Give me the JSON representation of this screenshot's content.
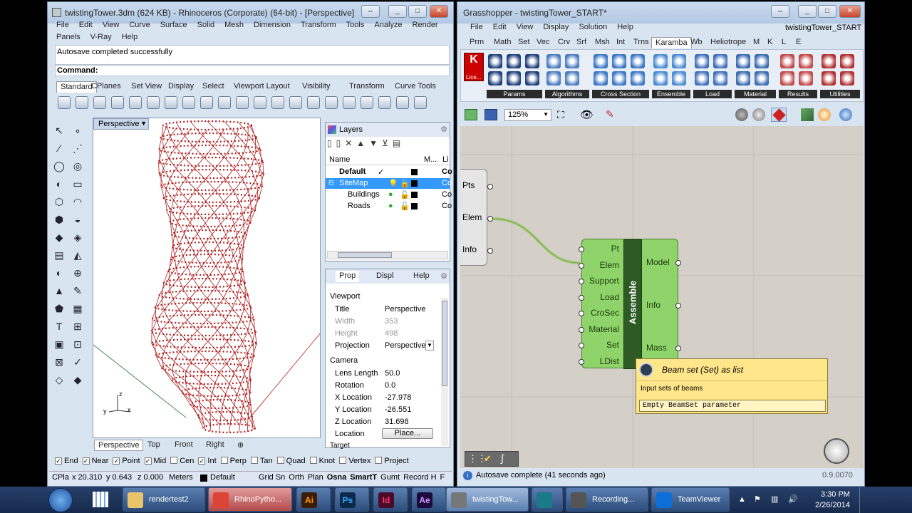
{
  "rhino": {
    "title": "twistingTower.3dm (624 KB) - Rhinoceros (Corporate) (64-bit) - [Perspective]",
    "menu_row1": [
      "File",
      "Edit",
      "View",
      "Curve",
      "Surface",
      "Solid",
      "Mesh",
      "Dimension",
      "Transform",
      "Tools",
      "Analyze",
      "Render"
    ],
    "menu_row2": [
      "Panels",
      "V-Ray",
      "Help"
    ],
    "history": "Autosave completed successfully",
    "command_label": "Command:",
    "toolbar_tabs": [
      "Standard",
      "CPlanes",
      "Set View",
      "Display",
      "Select",
      "Viewport Layout",
      "Visibility",
      "Transform",
      "Curve Tools"
    ],
    "viewport_label": "Perspective",
    "viewport_tabs": [
      "Perspective",
      "Top",
      "Front",
      "Right"
    ],
    "axis_y": "y",
    "axis_z": "z",
    "axis_x": "x",
    "osnap": [
      {
        "label": "End",
        "checked": true
      },
      {
        "label": "Near",
        "checked": true
      },
      {
        "label": "Point",
        "checked": true
      },
      {
        "label": "Mid",
        "checked": true
      },
      {
        "label": "Cen",
        "checked": false
      },
      {
        "label": "Int",
        "checked": true
      },
      {
        "label": "Perp",
        "checked": false
      },
      {
        "label": "Tan",
        "checked": false
      },
      {
        "label": "Quad",
        "checked": false
      },
      {
        "label": "Knot",
        "checked": false
      },
      {
        "label": "Vertex",
        "checked": false
      },
      {
        "label": "Project",
        "checked": false
      }
    ],
    "status": {
      "cplane": "CPla",
      "x": "x 20.310",
      "y": "y 0.643",
      "z": "z 0.000",
      "units": "Meters",
      "layer": "Default",
      "toggles": [
        "Grid Sn",
        "Orth",
        "Plan",
        "Osna",
        "SmartT",
        "Gumt",
        "Record H",
        "F"
      ]
    },
    "layers": {
      "title": "Layers",
      "col_name": "Name",
      "col_m": "M...",
      "col_li": "Li",
      "rows": [
        {
          "name": "Default",
          "extra": "Co"
        },
        {
          "name": "SiteMap",
          "extra": "Co"
        },
        {
          "name": "Buildings",
          "extra": "Co"
        },
        {
          "name": "Roads",
          "extra": "Co"
        }
      ],
      "check": "✓"
    },
    "props": {
      "tabs": [
        "Prop",
        "Displ",
        "Help"
      ],
      "section_viewport": "Viewport",
      "title_k": "Title",
      "title_v": "Perspective",
      "width_k": "Width",
      "width_v": "353",
      "height_k": "Height",
      "height_v": "498",
      "proj_k": "Projection",
      "proj_v": "Perspective",
      "section_camera": "Camera",
      "lens_k": "Lens Length",
      "lens_v": "50.0",
      "rot_k": "Rotation",
      "rot_v": "0.0",
      "xl_k": "X Location",
      "xl_v": "-27.978",
      "yl_k": "Y Location",
      "yl_v": "-26.551",
      "zl_k": "Z Location",
      "zl_v": "31.698",
      "loc_k": "Location",
      "loc_btn": "Place...",
      "target": "Target"
    }
  },
  "gh": {
    "title": "Grasshopper - twistingTower_START*",
    "doc_name": "twistingTower_START",
    "menu": [
      "File",
      "Edit",
      "View",
      "Display",
      "Solution",
      "Help"
    ],
    "tabs": [
      "Prm",
      "Math",
      "Set",
      "Vec",
      "Crv",
      "Srf",
      "Msh",
      "Int",
      "Trns",
      "Karamba",
      "Wb",
      "Heliotrope",
      "M",
      "K",
      "L",
      "E"
    ],
    "active_tab": "Karamba",
    "lic_label": "Lice...",
    "groups": [
      "Params",
      "Algorithms",
      "Cross Section",
      "Ensemble",
      "Load",
      "Material",
      "Results",
      "Utilities"
    ],
    "zoom": "125%",
    "left_outputs": [
      "Pts",
      "Elem",
      "Info"
    ],
    "component": {
      "name": "Assemble",
      "inputs": [
        "Pt",
        "Elem",
        "Support",
        "Load",
        "CroSec",
        "Material",
        "Set",
        "LDist"
      ],
      "outputs": [
        "Model",
        "Info",
        "Mass"
      ]
    },
    "tooltip": {
      "title": "Beam set (Set) as list",
      "desc": "Input sets of beams",
      "value": "Empty BeamSet parameter"
    },
    "status": "Autosave complete (41 seconds ago)",
    "version": "0.9.0070"
  },
  "taskbar": {
    "items": [
      {
        "label": "rendertest2",
        "icon": "folder"
      },
      {
        "label": "RhinoPytho...",
        "icon": "chrome"
      },
      {
        "label": "",
        "icon": "Ai"
      },
      {
        "label": "",
        "icon": "Ps"
      },
      {
        "label": "",
        "icon": "Id"
      },
      {
        "label": "",
        "icon": "Ae"
      },
      {
        "label": "twistingTow...",
        "icon": "rhino"
      },
      {
        "label": "",
        "icon": "app"
      },
      {
        "label": "Recording...",
        "icon": "rec"
      },
      {
        "label": "TeamViewer",
        "icon": "tv"
      }
    ],
    "time": "3:30 PM",
    "date": "2/26/2014"
  },
  "colors": {
    "tower": "#b01d1d",
    "gh_comp": "#8fd36b",
    "tooltip": "#ffe68a"
  }
}
